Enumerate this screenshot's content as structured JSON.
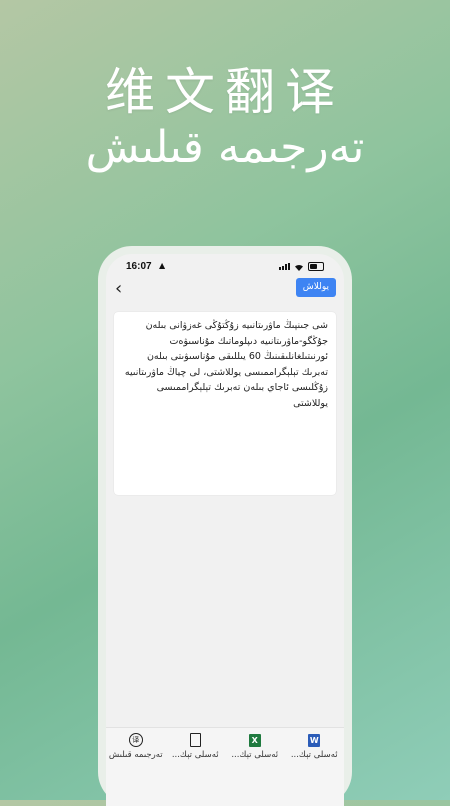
{
  "promo": {
    "title_zh": "维文翻译",
    "title_ug": "تەرجىمە قىلىش"
  },
  "status_bar": {
    "time": "16:07"
  },
  "header": {
    "primary_button_label": "يوللاش"
  },
  "editor": {
    "text": "شى جىنپىڭ ماۋرىتانىيە زۇڭتۇڭى غەزۋانى بىلەن جۇڭگو-ماۋرىتانىيە دىپلوماتىك مۇناسىۋەت ئورنىتىلغانلىقىنىڭ 60 يىللىقى مۇناسىۋىتى بىلەن تەبرىك تېلېگراممىسى يوللاشتى، لى چياڭ ماۋرىتانىيە زۇڭلىسى ئاجاي بىلەن تەبرىك تېلېگراممىسى يوللاشتى"
  },
  "tabbar": {
    "items": [
      {
        "label": "ئەسلى تېك...",
        "icon": "word-icon"
      },
      {
        "label": "ئەسلى تېك...",
        "icon": "excel-icon"
      },
      {
        "label": "ئەسلى تېك...",
        "icon": "document-icon"
      },
      {
        "label": "تەرجىمە قىلىش",
        "icon": "translate-icon"
      }
    ]
  }
}
